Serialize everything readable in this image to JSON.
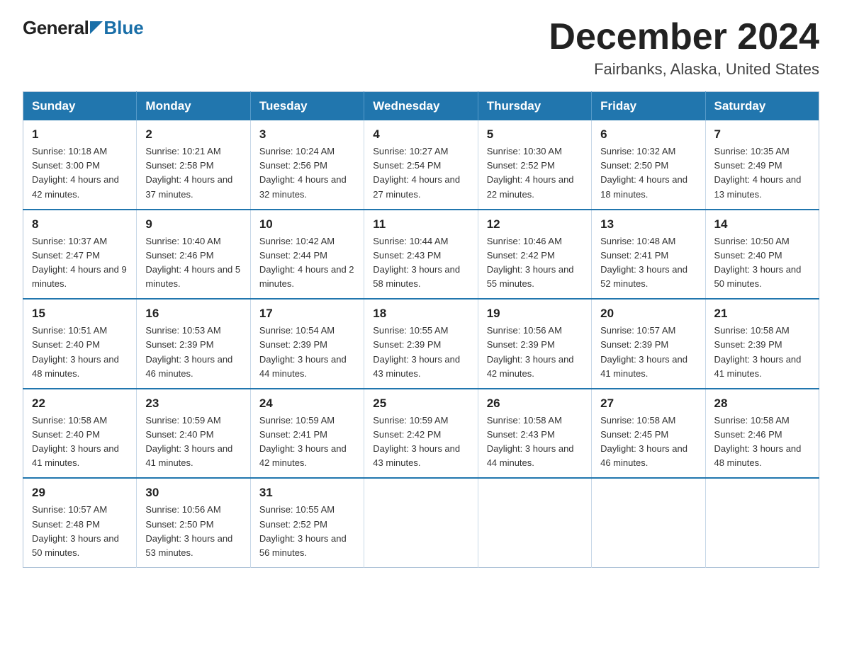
{
  "logo": {
    "general": "General",
    "blue": "Blue"
  },
  "title": "December 2024",
  "subtitle": "Fairbanks, Alaska, United States",
  "days_of_week": [
    "Sunday",
    "Monday",
    "Tuesday",
    "Wednesday",
    "Thursday",
    "Friday",
    "Saturday"
  ],
  "weeks": [
    [
      {
        "day": "1",
        "sunrise": "Sunrise: 10:18 AM",
        "sunset": "Sunset: 3:00 PM",
        "daylight": "Daylight: 4 hours and 42 minutes."
      },
      {
        "day": "2",
        "sunrise": "Sunrise: 10:21 AM",
        "sunset": "Sunset: 2:58 PM",
        "daylight": "Daylight: 4 hours and 37 minutes."
      },
      {
        "day": "3",
        "sunrise": "Sunrise: 10:24 AM",
        "sunset": "Sunset: 2:56 PM",
        "daylight": "Daylight: 4 hours and 32 minutes."
      },
      {
        "day": "4",
        "sunrise": "Sunrise: 10:27 AM",
        "sunset": "Sunset: 2:54 PM",
        "daylight": "Daylight: 4 hours and 27 minutes."
      },
      {
        "day": "5",
        "sunrise": "Sunrise: 10:30 AM",
        "sunset": "Sunset: 2:52 PM",
        "daylight": "Daylight: 4 hours and 22 minutes."
      },
      {
        "day": "6",
        "sunrise": "Sunrise: 10:32 AM",
        "sunset": "Sunset: 2:50 PM",
        "daylight": "Daylight: 4 hours and 18 minutes."
      },
      {
        "day": "7",
        "sunrise": "Sunrise: 10:35 AM",
        "sunset": "Sunset: 2:49 PM",
        "daylight": "Daylight: 4 hours and 13 minutes."
      }
    ],
    [
      {
        "day": "8",
        "sunrise": "Sunrise: 10:37 AM",
        "sunset": "Sunset: 2:47 PM",
        "daylight": "Daylight: 4 hours and 9 minutes."
      },
      {
        "day": "9",
        "sunrise": "Sunrise: 10:40 AM",
        "sunset": "Sunset: 2:46 PM",
        "daylight": "Daylight: 4 hours and 5 minutes."
      },
      {
        "day": "10",
        "sunrise": "Sunrise: 10:42 AM",
        "sunset": "Sunset: 2:44 PM",
        "daylight": "Daylight: 4 hours and 2 minutes."
      },
      {
        "day": "11",
        "sunrise": "Sunrise: 10:44 AM",
        "sunset": "Sunset: 2:43 PM",
        "daylight": "Daylight: 3 hours and 58 minutes."
      },
      {
        "day": "12",
        "sunrise": "Sunrise: 10:46 AM",
        "sunset": "Sunset: 2:42 PM",
        "daylight": "Daylight: 3 hours and 55 minutes."
      },
      {
        "day": "13",
        "sunrise": "Sunrise: 10:48 AM",
        "sunset": "Sunset: 2:41 PM",
        "daylight": "Daylight: 3 hours and 52 minutes."
      },
      {
        "day": "14",
        "sunrise": "Sunrise: 10:50 AM",
        "sunset": "Sunset: 2:40 PM",
        "daylight": "Daylight: 3 hours and 50 minutes."
      }
    ],
    [
      {
        "day": "15",
        "sunrise": "Sunrise: 10:51 AM",
        "sunset": "Sunset: 2:40 PM",
        "daylight": "Daylight: 3 hours and 48 minutes."
      },
      {
        "day": "16",
        "sunrise": "Sunrise: 10:53 AM",
        "sunset": "Sunset: 2:39 PM",
        "daylight": "Daylight: 3 hours and 46 minutes."
      },
      {
        "day": "17",
        "sunrise": "Sunrise: 10:54 AM",
        "sunset": "Sunset: 2:39 PM",
        "daylight": "Daylight: 3 hours and 44 minutes."
      },
      {
        "day": "18",
        "sunrise": "Sunrise: 10:55 AM",
        "sunset": "Sunset: 2:39 PM",
        "daylight": "Daylight: 3 hours and 43 minutes."
      },
      {
        "day": "19",
        "sunrise": "Sunrise: 10:56 AM",
        "sunset": "Sunset: 2:39 PM",
        "daylight": "Daylight: 3 hours and 42 minutes."
      },
      {
        "day": "20",
        "sunrise": "Sunrise: 10:57 AM",
        "sunset": "Sunset: 2:39 PM",
        "daylight": "Daylight: 3 hours and 41 minutes."
      },
      {
        "day": "21",
        "sunrise": "Sunrise: 10:58 AM",
        "sunset": "Sunset: 2:39 PM",
        "daylight": "Daylight: 3 hours and 41 minutes."
      }
    ],
    [
      {
        "day": "22",
        "sunrise": "Sunrise: 10:58 AM",
        "sunset": "Sunset: 2:40 PM",
        "daylight": "Daylight: 3 hours and 41 minutes."
      },
      {
        "day": "23",
        "sunrise": "Sunrise: 10:59 AM",
        "sunset": "Sunset: 2:40 PM",
        "daylight": "Daylight: 3 hours and 41 minutes."
      },
      {
        "day": "24",
        "sunrise": "Sunrise: 10:59 AM",
        "sunset": "Sunset: 2:41 PM",
        "daylight": "Daylight: 3 hours and 42 minutes."
      },
      {
        "day": "25",
        "sunrise": "Sunrise: 10:59 AM",
        "sunset": "Sunset: 2:42 PM",
        "daylight": "Daylight: 3 hours and 43 minutes."
      },
      {
        "day": "26",
        "sunrise": "Sunrise: 10:58 AM",
        "sunset": "Sunset: 2:43 PM",
        "daylight": "Daylight: 3 hours and 44 minutes."
      },
      {
        "day": "27",
        "sunrise": "Sunrise: 10:58 AM",
        "sunset": "Sunset: 2:45 PM",
        "daylight": "Daylight: 3 hours and 46 minutes."
      },
      {
        "day": "28",
        "sunrise": "Sunrise: 10:58 AM",
        "sunset": "Sunset: 2:46 PM",
        "daylight": "Daylight: 3 hours and 48 minutes."
      }
    ],
    [
      {
        "day": "29",
        "sunrise": "Sunrise: 10:57 AM",
        "sunset": "Sunset: 2:48 PM",
        "daylight": "Daylight: 3 hours and 50 minutes."
      },
      {
        "day": "30",
        "sunrise": "Sunrise: 10:56 AM",
        "sunset": "Sunset: 2:50 PM",
        "daylight": "Daylight: 3 hours and 53 minutes."
      },
      {
        "day": "31",
        "sunrise": "Sunrise: 10:55 AM",
        "sunset": "Sunset: 2:52 PM",
        "daylight": "Daylight: 3 hours and 56 minutes."
      },
      null,
      null,
      null,
      null
    ]
  ]
}
